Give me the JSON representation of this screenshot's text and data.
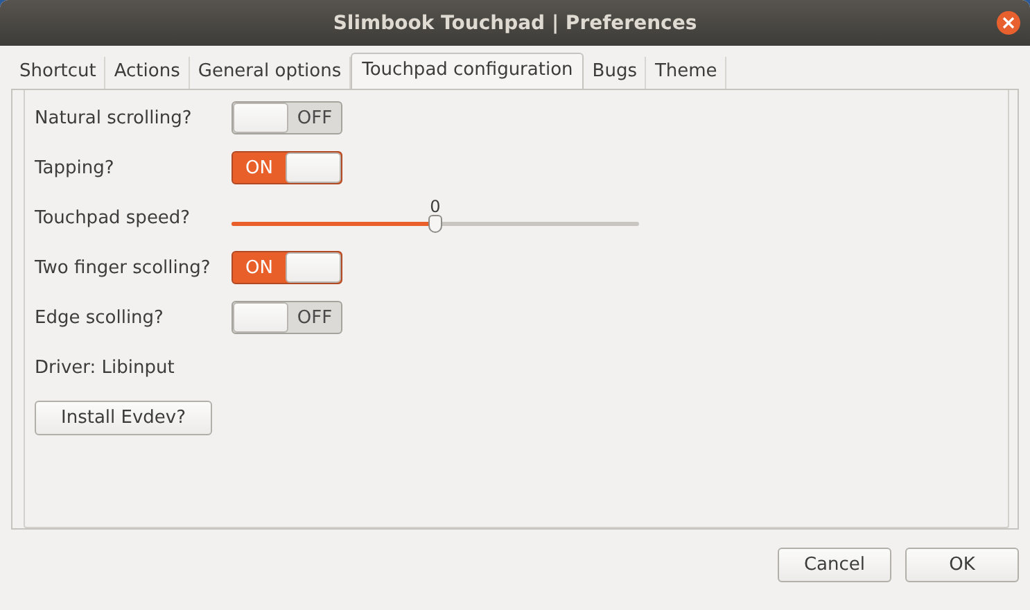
{
  "window": {
    "title": "Slimbook Touchpad | Preferences"
  },
  "tabs": [
    {
      "label": "Shortcut",
      "selected": false
    },
    {
      "label": "Actions",
      "selected": false
    },
    {
      "label": "General options",
      "selected": false
    },
    {
      "label": "Touchpad configuration",
      "selected": true
    },
    {
      "label": "Bugs",
      "selected": false
    },
    {
      "label": "Theme",
      "selected": false
    }
  ],
  "settings": [
    {
      "kind": "switch",
      "label": "Natural scrolling?",
      "on": false,
      "state_text": "OFF"
    },
    {
      "kind": "switch",
      "label": "Tapping?",
      "on": true,
      "state_text": "ON"
    },
    {
      "kind": "slider",
      "label": "Touchpad speed?",
      "level": 0.5,
      "reading": "0"
    },
    {
      "kind": "switch",
      "label": "Two finger scolling?",
      "on": true,
      "state_text": "ON"
    },
    {
      "kind": "switch",
      "label": "Edge scolling?",
      "on": false,
      "state_text": "OFF"
    },
    {
      "kind": "text",
      "label": "Driver: Libinput"
    },
    {
      "kind": "button",
      "label": "Install Evdev?"
    }
  ],
  "buttons": [
    "Cancel",
    "OK"
  ]
}
